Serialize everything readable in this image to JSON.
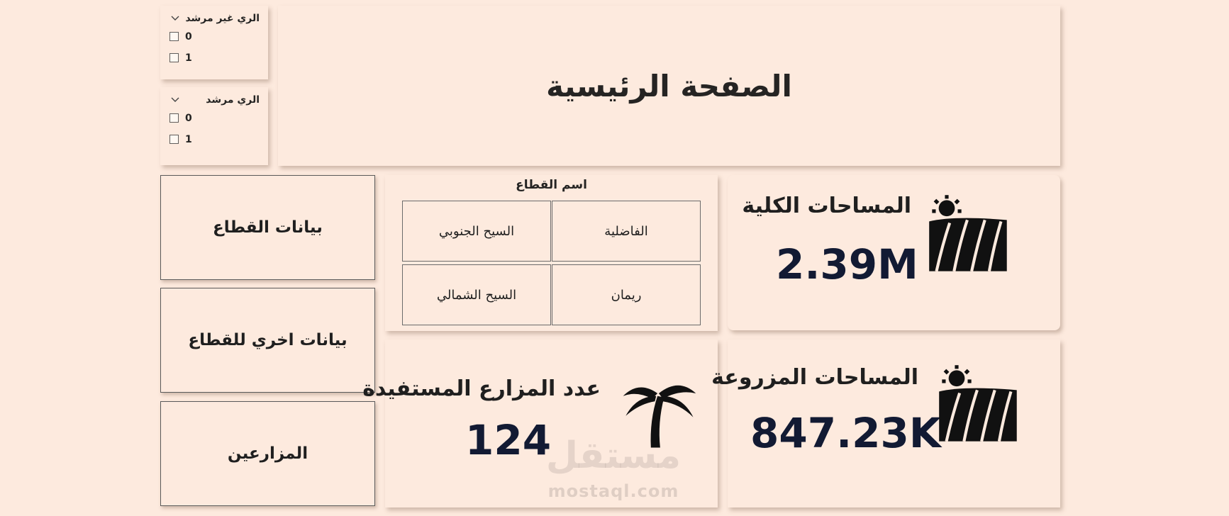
{
  "slicers": {
    "unguided": {
      "title": "الري غير مرشد",
      "options": [
        "0",
        "1"
      ]
    },
    "guided": {
      "title": "الري مرشد",
      "options": [
        "0",
        "1"
      ]
    }
  },
  "header": {
    "title": "الصفحة الرئيسية"
  },
  "nav": {
    "sector_data": "بيانات القطاع",
    "other_sector_data": "بيانات اخري للقطاع",
    "farmers": "المزارعين"
  },
  "sector_slicer": {
    "title": "اسم القطاع",
    "tiles": [
      "الفاضلية",
      "السيح الجنوبي",
      "ريمان",
      "السيح الشمالي"
    ]
  },
  "kpis": {
    "total_area": {
      "label": "المساحات الكلية",
      "value": "2.39M",
      "icon": "farm-field-sun-icon"
    },
    "cultivated_area": {
      "label": "المساحات المزروعة",
      "value": "847.23K",
      "icon": "farm-field-sun-icon"
    },
    "farms_count": {
      "label": "عدد المزارع المستفيدة",
      "value": "124",
      "icon": "palm-tree-icon"
    }
  },
  "watermark": {
    "text": "mostaql.com",
    "logo_text": "مستقل"
  }
}
